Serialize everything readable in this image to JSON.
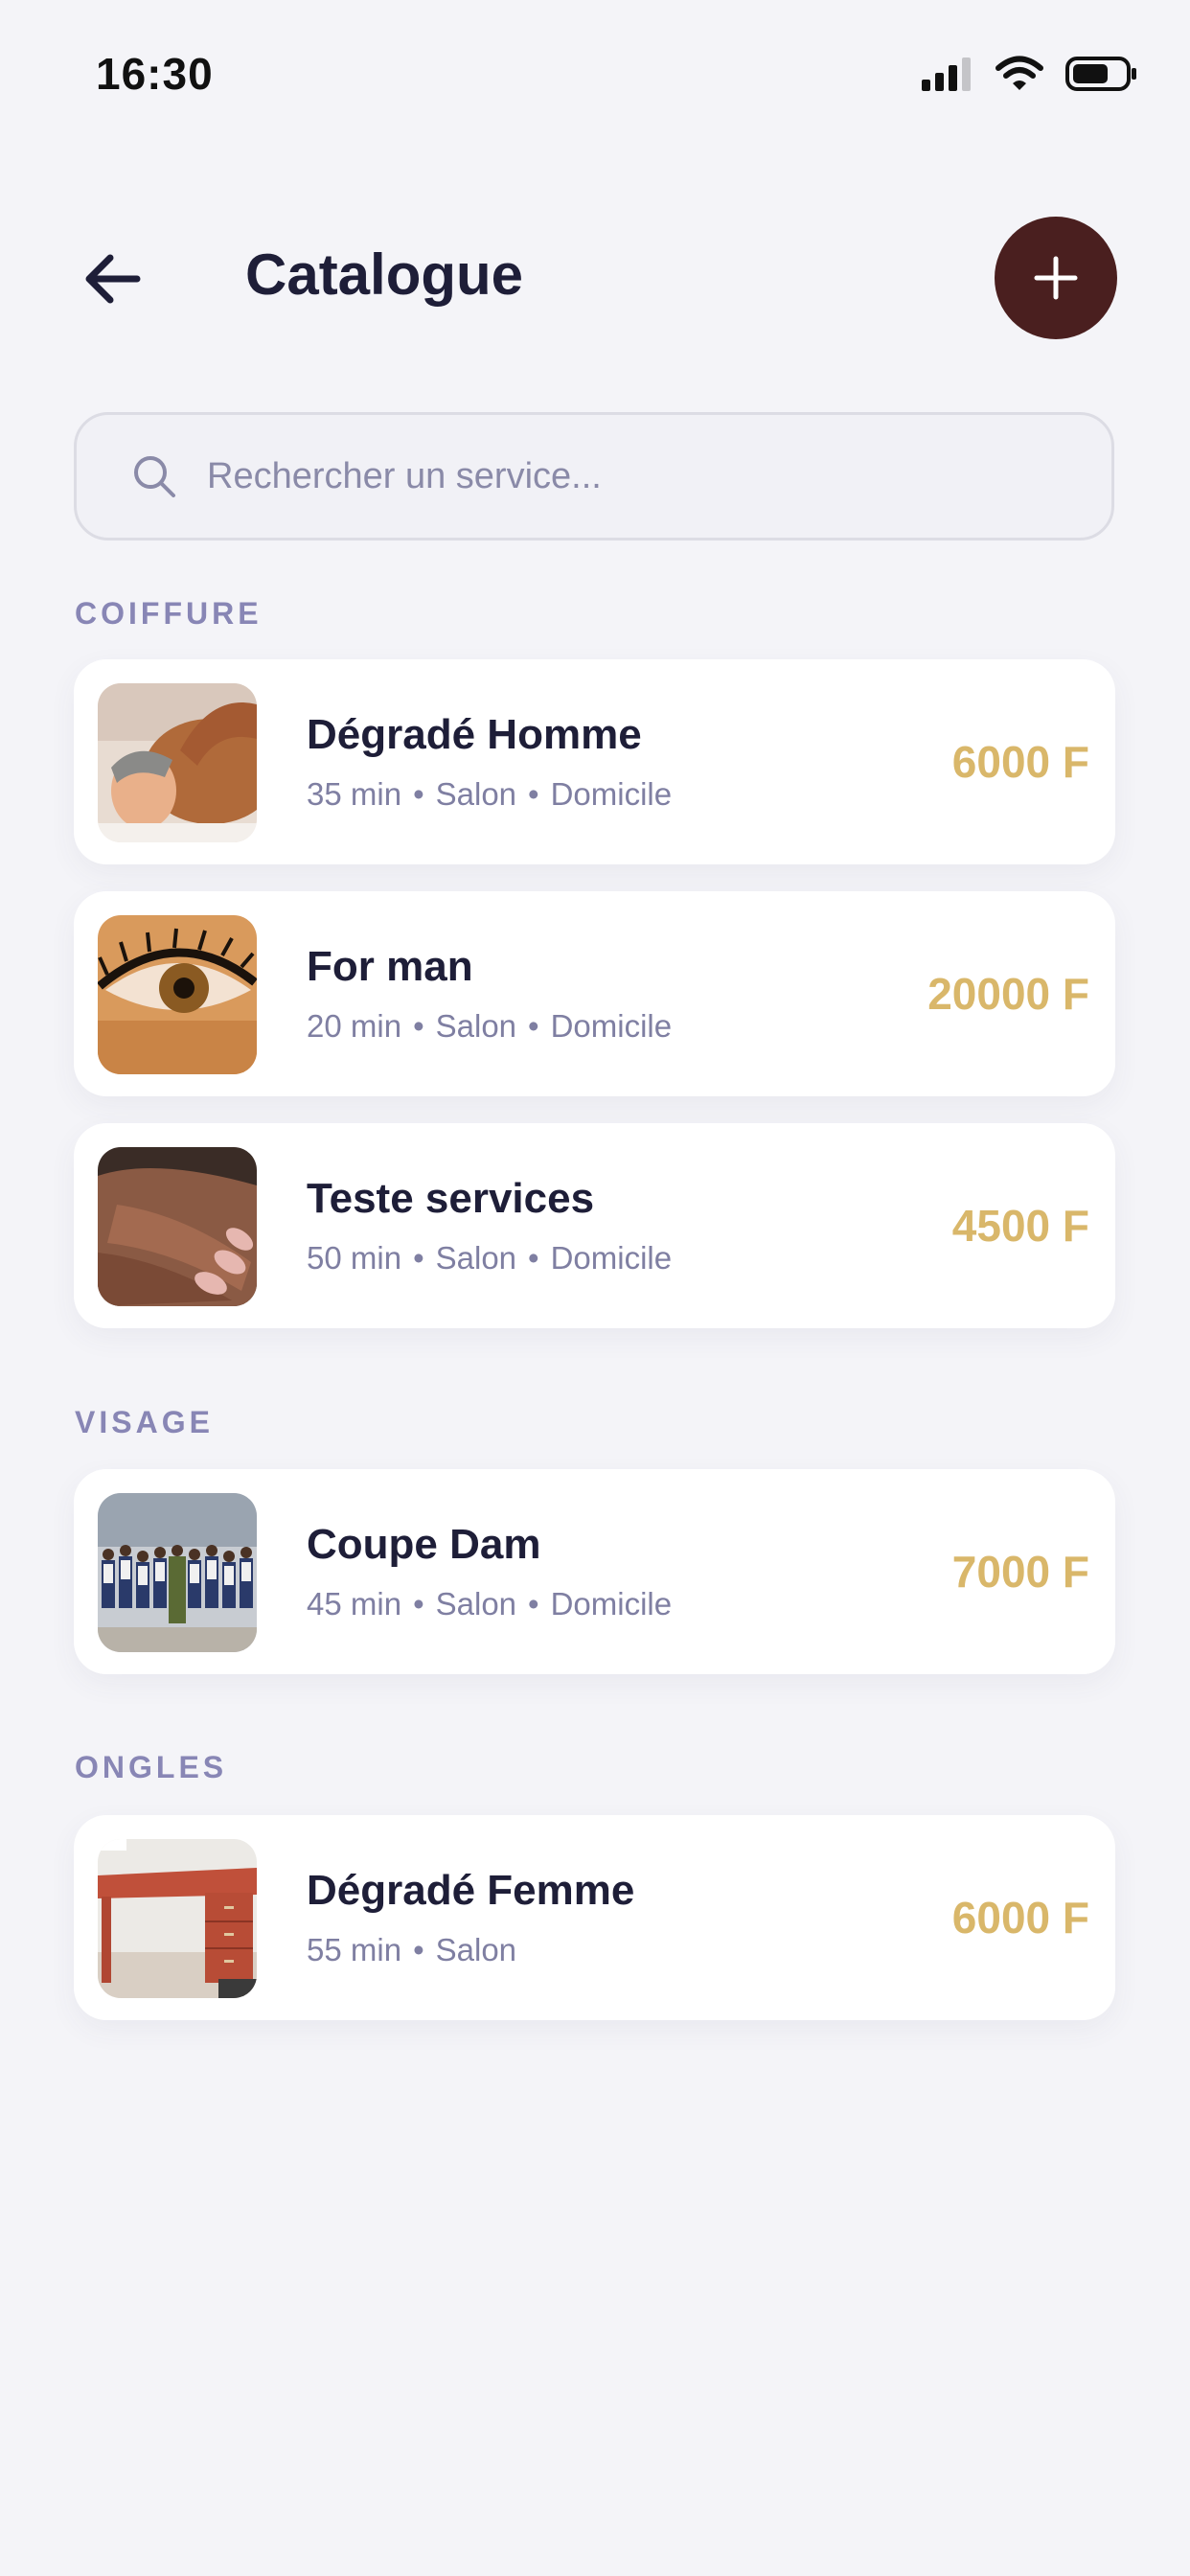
{
  "status_bar": {
    "time": "16:30"
  },
  "header": {
    "title": "Catalogue"
  },
  "search": {
    "placeholder": "Rechercher un service..."
  },
  "colors": {
    "accent": "#4a1f1f",
    "price": "#d9b76a",
    "section_label": "#8886b5",
    "muted": "#7f7fa2",
    "background": "#f4f4f8"
  },
  "sections": [
    {
      "label": "COIFFURE",
      "services": [
        {
          "name": "Dégradé Homme",
          "duration": "35 min",
          "tags": [
            "Salon",
            "Domicile"
          ],
          "price": "6000 F",
          "image": "massage-photo"
        },
        {
          "name": "For man",
          "duration": "20 min",
          "tags": [
            "Salon",
            "Domicile"
          ],
          "price": "20000 F",
          "image": "eye-lashes-photo"
        },
        {
          "name": "Teste services",
          "duration": "50 min",
          "tags": [
            "Salon",
            "Domicile"
          ],
          "price": "4500 F",
          "image": "manicure-photo"
        }
      ]
    },
    {
      "label": "VISAGE",
      "services": [
        {
          "name": "Coupe Dam",
          "duration": "45 min",
          "tags": [
            "Salon",
            "Domicile"
          ],
          "price": "7000 F",
          "image": "group-photo"
        }
      ]
    },
    {
      "label": "ONGLES",
      "services": [
        {
          "name": "Dégradé Femme",
          "duration": "55 min",
          "tags": [
            "Salon"
          ],
          "price": "6000 F",
          "image": "desk-photo"
        }
      ]
    }
  ]
}
